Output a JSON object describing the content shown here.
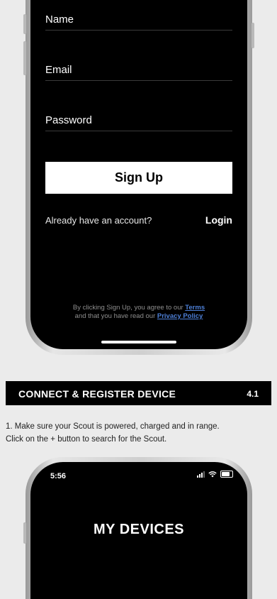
{
  "signup_screen": {
    "fields": [
      {
        "label": "Name"
      },
      {
        "label": "Email"
      },
      {
        "label": "Password"
      }
    ],
    "signup_button": "Sign Up",
    "already_text": "Already have an account?",
    "login_link": "Login",
    "legal": {
      "line1_prefix": "By clicking Sign Up, you agree to our",
      "terms_link": "Terms",
      "line2_prefix": "and that you have read our",
      "privacy_link": "Privacy Policy"
    }
  },
  "section": {
    "title": "CONNECT & REGISTER DEVICE",
    "number": "4.1"
  },
  "instruction": {
    "line1": "1. Make sure your Scout is powered, charged and in range.",
    "line2": "Click on the + button to search for the Scout."
  },
  "devices_screen": {
    "status_time": "5:56",
    "title": "MY DEVICES"
  },
  "colors": {
    "background": "#ebebeb",
    "screen": "#000000",
    "link": "#4d7fd6"
  }
}
